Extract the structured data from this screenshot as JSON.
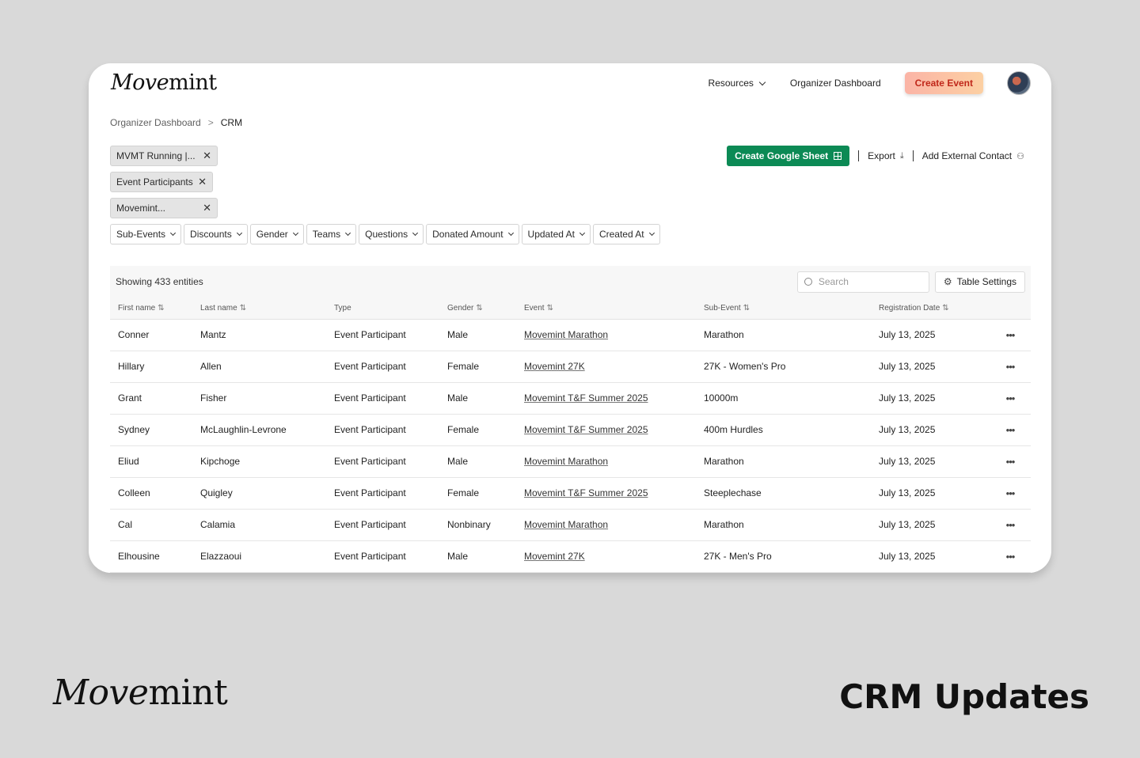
{
  "brand": {
    "logo_italic": "Move",
    "logo_rest": "mint"
  },
  "nav": {
    "resources": "Resources",
    "organizer_dashboard": "Organizer Dashboard",
    "create_event": "Create Event"
  },
  "breadcrumb": {
    "parent": "Organizer Dashboard",
    "separator": ">",
    "current": "CRM"
  },
  "chips": [
    {
      "label": "MVMT Running |..."
    },
    {
      "label": "Event Participants"
    },
    {
      "label": "Movemint..."
    }
  ],
  "filters": [
    "Sub-Events",
    "Discounts",
    "Gender",
    "Teams",
    "Questions",
    "Donated Amount",
    "Updated At",
    "Created At"
  ],
  "actions": {
    "create_google_sheet": "Create Google Sheet",
    "export": "Export",
    "add_external_contact": "Add External Contact"
  },
  "table": {
    "showing": "Showing 433 entities",
    "search_placeholder": "Search",
    "table_settings": "Table Settings",
    "columns": [
      {
        "label": "First name",
        "sortable": true
      },
      {
        "label": "Last name",
        "sortable": true
      },
      {
        "label": "Type",
        "sortable": false
      },
      {
        "label": "Gender",
        "sortable": true
      },
      {
        "label": "Event",
        "sortable": true
      },
      {
        "label": "Sub-Event",
        "sortable": true
      },
      {
        "label": "Registration Date",
        "sortable": true
      }
    ],
    "rows": [
      {
        "first": "Conner",
        "last": "Mantz",
        "type": "Event Participant",
        "gender": "Male",
        "event": "Movemint Marathon",
        "sub_event": "Marathon",
        "date": "July 13, 2025"
      },
      {
        "first": "Hillary",
        "last": "Allen",
        "type": "Event Participant",
        "gender": "Female",
        "event": "Movemint 27K",
        "sub_event": "27K - Women's Pro",
        "date": "July 13, 2025"
      },
      {
        "first": "Grant",
        "last": "Fisher",
        "type": "Event Participant",
        "gender": "Male",
        "event": "Movemint T&F Summer 2025",
        "sub_event": "10000m",
        "date": "July 13, 2025"
      },
      {
        "first": "Sydney",
        "last": "McLaughlin-Levrone",
        "type": "Event Participant",
        "gender": "Female",
        "event": "Movemint T&F Summer 2025",
        "sub_event": "400m Hurdles",
        "date": "July 13, 2025"
      },
      {
        "first": "Eliud",
        "last": "Kipchoge",
        "type": "Event Participant",
        "gender": "Male",
        "event": "Movemint Marathon",
        "sub_event": "Marathon",
        "date": "July 13, 2025"
      },
      {
        "first": "Colleen",
        "last": "Quigley",
        "type": "Event Participant",
        "gender": "Female",
        "event": "Movemint T&F Summer 2025",
        "sub_event": "Steeplechase",
        "date": "July 13, 2025"
      },
      {
        "first": "Cal",
        "last": "Calamia",
        "type": "Event Participant",
        "gender": "Nonbinary",
        "event": "Movemint Marathon",
        "sub_event": "Marathon",
        "date": "July 13, 2025"
      },
      {
        "first": "Elhousine",
        "last": "Elazzaoui",
        "type": "Event Participant",
        "gender": "Male",
        "event": "Movemint 27K",
        "sub_event": "27K - Men's Pro",
        "date": "July 13, 2025"
      }
    ]
  },
  "caption": "CRM Updates",
  "colors": {
    "primary_green": "#0c8a55",
    "create_event_text": "#c0271a",
    "background": "#d9d9d9"
  }
}
